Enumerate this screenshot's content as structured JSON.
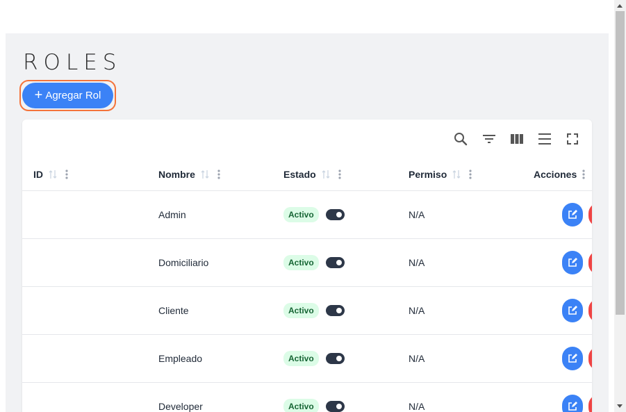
{
  "page": {
    "title": "ROLES"
  },
  "add_button": {
    "label": "Agregar Rol"
  },
  "columns": {
    "id": "ID",
    "name": "Nombre",
    "status": "Estado",
    "permission": "Permiso",
    "actions": "Acciones"
  },
  "rows": [
    {
      "id": "",
      "name": "Admin",
      "status": "Activo",
      "active": true,
      "permission": "N/A"
    },
    {
      "id": "",
      "name": "Domiciliario",
      "status": "Activo",
      "active": true,
      "permission": "N/A"
    },
    {
      "id": "",
      "name": "Cliente",
      "status": "Activo",
      "active": true,
      "permission": "N/A"
    },
    {
      "id": "",
      "name": "Empleado",
      "status": "Activo",
      "active": true,
      "permission": "N/A"
    },
    {
      "id": "",
      "name": "Developer",
      "status": "Activo",
      "active": true,
      "permission": "N/A"
    }
  ],
  "toolbar_icons": [
    "search-icon",
    "filter-icon",
    "columns-icon",
    "density-icon",
    "fullscreen-icon"
  ],
  "colors": {
    "primary": "#3b82f6",
    "danger": "#ef4444",
    "focus_ring": "#f4733a",
    "badge_bg": "#dcfce7",
    "badge_text": "#166534",
    "toggle_on": "#2d3748"
  }
}
